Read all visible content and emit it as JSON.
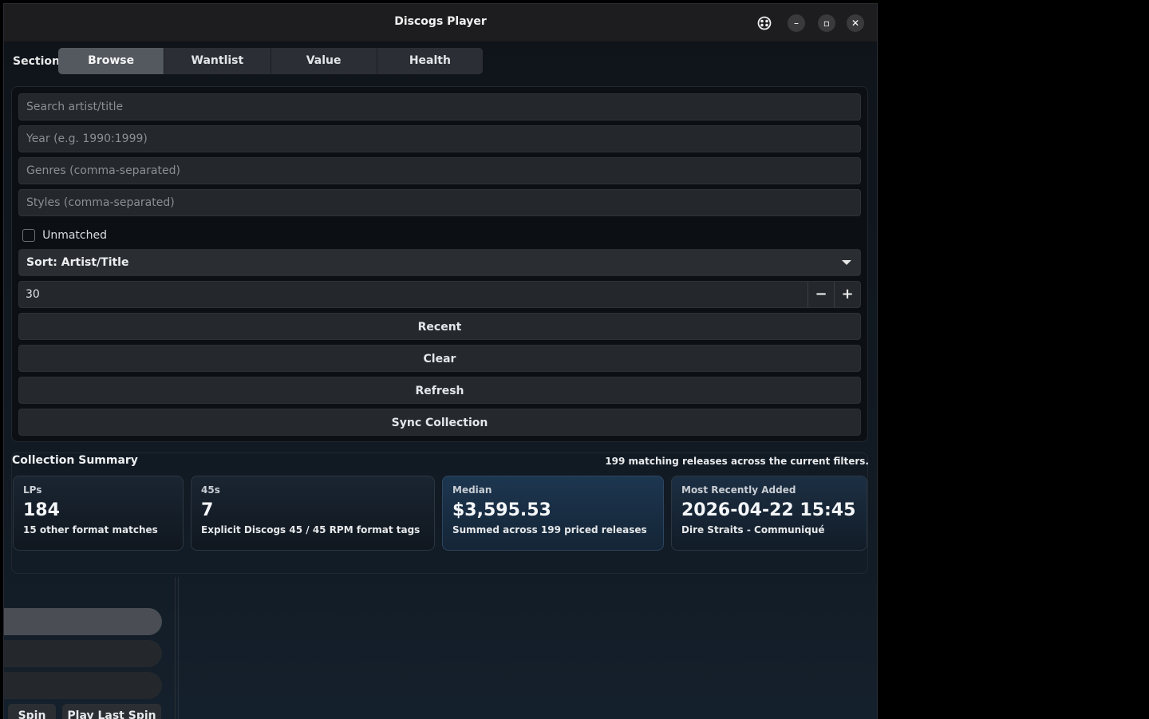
{
  "window": {
    "title": "Discogs Player",
    "controls": {
      "ext_icon": "puzzle-icon",
      "minimize": "–",
      "maximize": "▫",
      "close": "✕"
    }
  },
  "section": {
    "label": "Section",
    "tabs": [
      {
        "label": "Browse",
        "active": true
      },
      {
        "label": "Wantlist",
        "active": false
      },
      {
        "label": "Value",
        "active": false
      },
      {
        "label": "Health",
        "active": false
      }
    ]
  },
  "filters": {
    "search_placeholder": "Search artist/title",
    "year_placeholder": "Year (e.g. 1990:1999)",
    "genres_placeholder": "Genres (comma-separated)",
    "styles_placeholder": "Styles (comma-separated)",
    "unmatched_label": "Unmatched",
    "unmatched_checked": false,
    "sort_label": "Sort: Artist/Title",
    "limit_value": "30",
    "decrement": "−",
    "increment": "+",
    "recent_label": "Recent",
    "clear_label": "Clear",
    "refresh_label": "Refresh",
    "sync_label": "Sync Collection"
  },
  "summary": {
    "title": "Collection Summary",
    "subtitle": "199 matching releases across the current filters.",
    "cards": [
      {
        "label": "LPs",
        "value": "184",
        "note": "15 other format matches"
      },
      {
        "label": "45s",
        "value": "7",
        "note": "Explicit Discogs 45 / 45 RPM format tags"
      },
      {
        "label": "Median",
        "value": "$3,595.53",
        "note": "Summed across 199 priced releases"
      },
      {
        "label": "Most Recently Added",
        "value": "2026-04-22 15:45",
        "note": "Dire Straits - Communiqué"
      }
    ]
  },
  "player": {
    "spin_label": "Spin",
    "play_last_label": "Play Last Spin"
  }
}
